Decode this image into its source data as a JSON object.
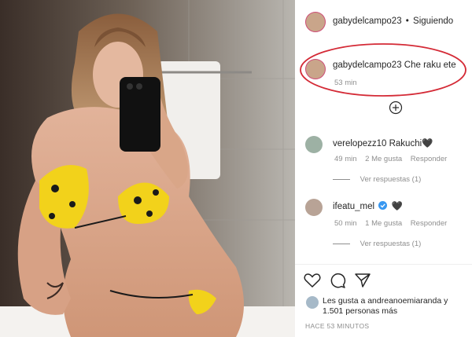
{
  "post": {
    "header": {
      "username": "gabydelcampo23",
      "separator": "•",
      "follow_status": "Siguiendo"
    },
    "caption": {
      "username": "gabydelcampo23",
      "text": "Che raku ete",
      "time": "53 min"
    },
    "comments": [
      {
        "username": "verelopezz10",
        "text": "Rakuchi🖤",
        "time": "49 min",
        "likes": "2 Me gusta",
        "reply": "Responder",
        "view_replies": "Ver respuestas (1)"
      },
      {
        "username": "ifeatu_mel",
        "text": "🖤",
        "time": "50 min",
        "likes": "1 Me gusta",
        "reply": "Responder",
        "view_replies": "Ver respuestas (1)",
        "verified": true
      }
    ],
    "likes": {
      "prefix": "Les gusta a",
      "user": "andreanoemiaranda",
      "joiner": "y",
      "others": "1.501 personas más"
    },
    "timestamp": "HACE 53 MINUTOS"
  },
  "icons": [
    "heart-icon",
    "comment-icon",
    "share-icon",
    "load-more-icon",
    "verified-icon"
  ],
  "colors": {
    "highlight_circle": "#d42a36",
    "verified": "#3897f0",
    "muted": "#8e8e8e"
  }
}
